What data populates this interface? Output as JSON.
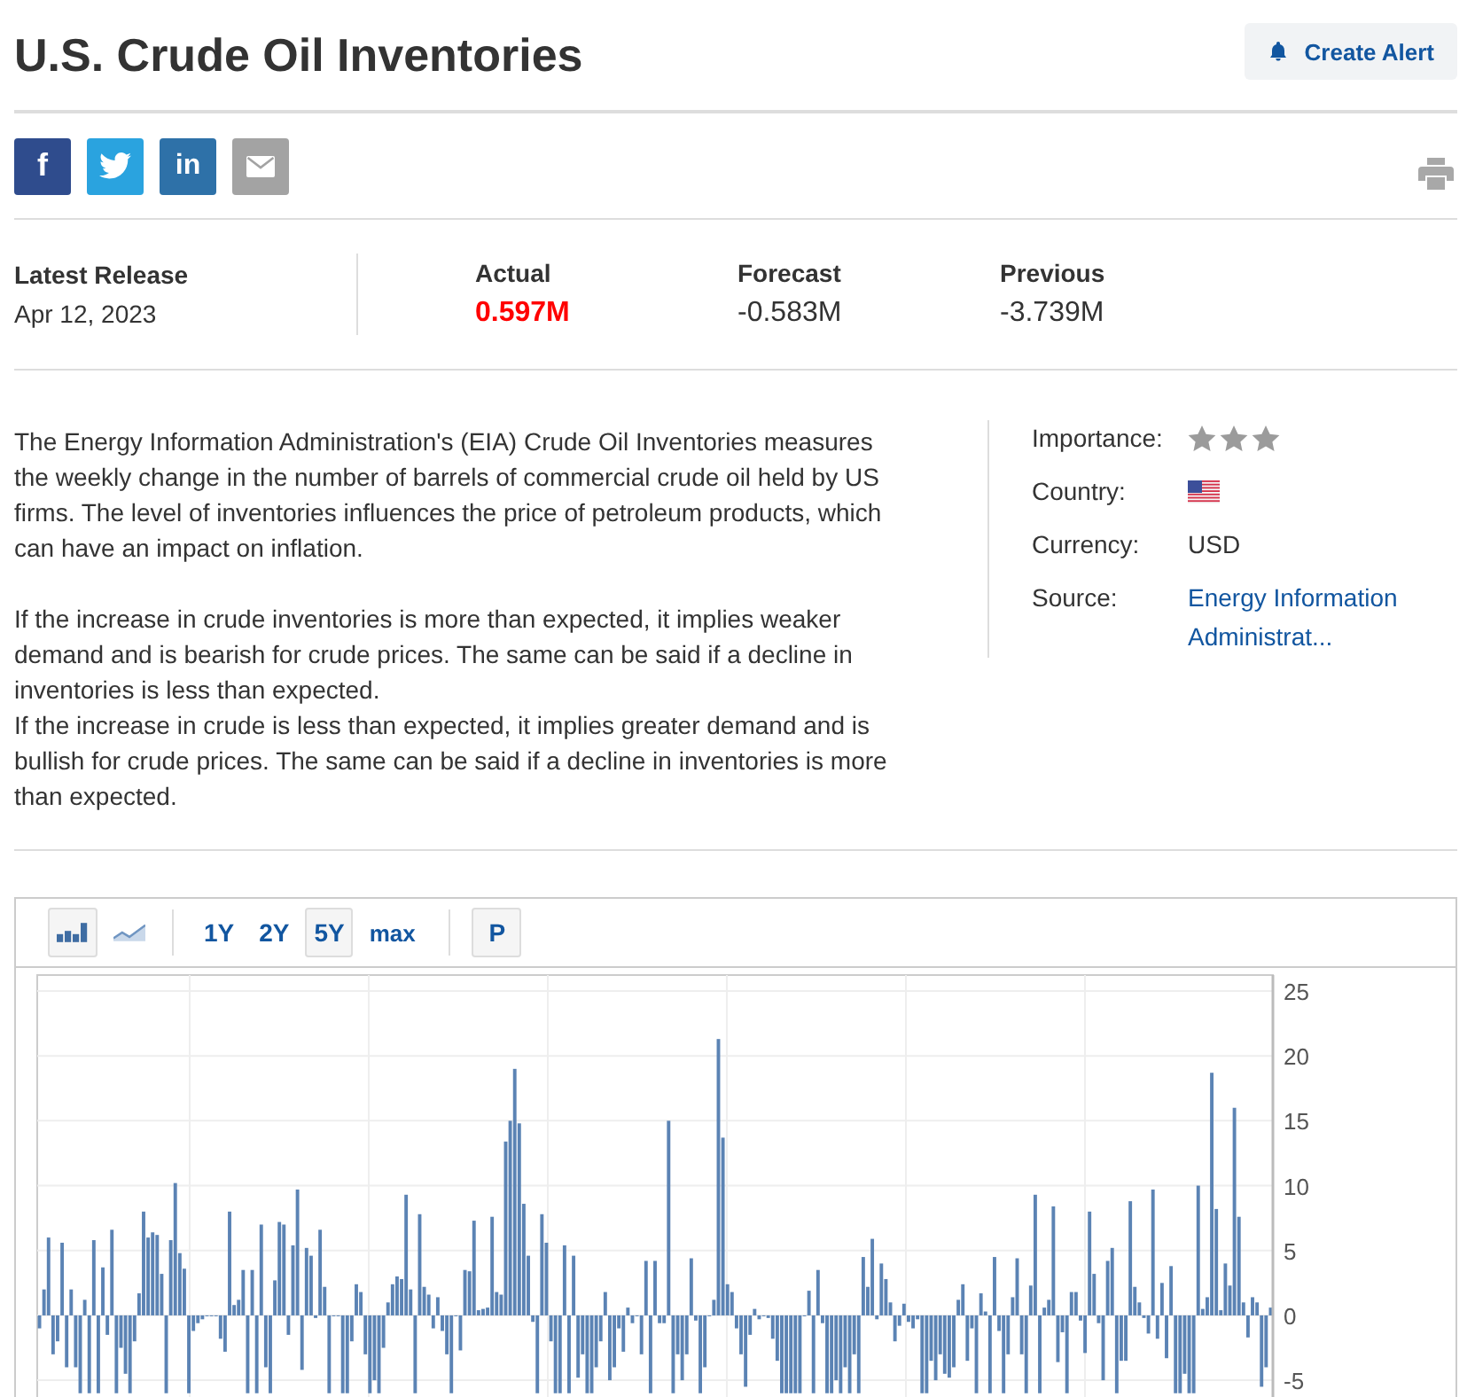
{
  "title": "U.S. Crude Oil Inventories",
  "alert_button": {
    "label": "Create Alert"
  },
  "share_buttons": [
    {
      "kind": "facebook",
      "label": "f"
    },
    {
      "kind": "twitter"
    },
    {
      "kind": "linkedin",
      "label": "in"
    },
    {
      "kind": "email"
    }
  ],
  "release": {
    "label": "Latest Release",
    "date": "Apr 12, 2023"
  },
  "figures": [
    {
      "label": "Actual",
      "value": "0.597M",
      "highlight": true
    },
    {
      "label": "Forecast",
      "value": "-0.583M",
      "highlight": false
    },
    {
      "label": "Previous",
      "value": "-3.739M",
      "highlight": false
    }
  ],
  "description": [
    [
      "The Energy Information Administration's (EIA) Crude Oil Inventories measures the weekly change in the number of barrels of commercial crude oil held by US firms. The level of inventories influences the price of petroleum products, which can have an impact on inflation."
    ],
    [
      "If the increase in crude inventories is more than expected, it implies weaker demand and is bearish for crude prices. The same can be said if a decline in inventories is less than expected.",
      "If the increase in crude is less than expected, it implies greater demand and is bullish for crude prices. The same can be said if a decline in inventories is more than expected."
    ]
  ],
  "details": [
    {
      "kind": "stars",
      "label": "Importance:",
      "stars": 3
    },
    {
      "kind": "flag",
      "label": "Country:"
    },
    {
      "kind": "text",
      "label": "Currency:",
      "value": "USD"
    },
    {
      "kind": "link",
      "label": "Source:",
      "value": "Energy Information Administrat..."
    }
  ],
  "chart_toolbar": {
    "chart_types": [
      {
        "kind": "bar",
        "selected": true
      },
      {
        "kind": "line",
        "selected": false
      }
    ],
    "ranges": [
      {
        "label": "1Y",
        "selected": false
      },
      {
        "label": "2Y",
        "selected": false
      },
      {
        "label": "5Y",
        "selected": true
      },
      {
        "label": "max",
        "selected": false
      }
    ],
    "p_button": {
      "label": "P"
    }
  },
  "chart": {
    "chart_data": {
      "type": "bar",
      "grid": true,
      "ylim": [
        -6.7,
        25
      ],
      "yticks": [
        -5,
        0,
        5,
        10,
        15,
        20,
        25
      ],
      "values": [
        -1,
        2,
        6,
        -3,
        -2,
        5.6,
        -4,
        2,
        -4,
        -6,
        1.2,
        -6,
        5.8,
        -6,
        3.7,
        -1.5,
        6.6,
        -6,
        -2.5,
        -4.5,
        -6,
        -2,
        1.7,
        8,
        6,
        6.4,
        6.2,
        3.2,
        -6,
        5.8,
        10.2,
        4.8,
        3.6,
        -6,
        -1.2,
        -0.6,
        -0.3,
        0,
        0,
        0,
        -1.8,
        -2.8,
        8,
        0.8,
        1.2,
        3.5,
        -6,
        3.5,
        -6,
        7,
        -4,
        -6,
        2.7,
        7.2,
        7,
        -1.5,
        5.4,
        9.7,
        -4.2,
        5.2,
        4.6,
        -0.2,
        6.6,
        2.2,
        -6,
        0,
        0,
        -6,
        -6,
        -2,
        2.4,
        1.8,
        -3,
        -6,
        -5,
        -6,
        -2.5,
        1,
        2.4,
        3,
        2.8,
        9.3,
        2,
        -6,
        7.8,
        2.2,
        1.6,
        -1,
        1.4,
        -1.2,
        -3,
        -6,
        0,
        -2.7,
        3.5,
        3.4,
        7.3,
        0.4,
        0.5,
        0.6,
        7.6,
        1.8,
        1.6,
        13.4,
        15,
        19,
        14.8,
        8.6,
        4.6,
        -0.5,
        -6,
        7.8,
        5.6,
        -2,
        -6,
        -6,
        5.4,
        -6,
        4.6,
        -4.8,
        -3,
        -6,
        -6,
        -4,
        -2,
        1.8,
        -5,
        -4,
        -1,
        -2.8,
        0.6,
        -0.6,
        0,
        -3,
        4.2,
        -6,
        4.2,
        -0.6,
        -0.6,
        15,
        -6,
        -3,
        -5,
        -3,
        4.4,
        -0.4,
        -6,
        -4,
        0,
        1.2,
        21.3,
        13.7,
        2.4,
        1.8,
        -1,
        -3,
        -5.5,
        -1.5,
        0.5,
        -0.3,
        0,
        -0.2,
        -1.8,
        -3.5,
        -6,
        -6,
        -6,
        -6,
        -6,
        0,
        1.9,
        -6,
        3.5,
        -0.6,
        -6,
        -6,
        -5,
        -6,
        -4,
        -6,
        -3,
        -6,
        4.5,
        2.2,
        5.9,
        -0.3,
        4,
        2.8,
        1,
        -2,
        -0.8,
        0.9,
        -0.5,
        -1,
        -0.3,
        -6,
        -6,
        -3.5,
        -5,
        -3,
        -4.5,
        -4.8,
        -4,
        1.2,
        2.4,
        -3.5,
        -1,
        -6,
        1.7,
        0.3,
        -6,
        4.5,
        -1.2,
        -6,
        -3,
        1.4,
        4.4,
        -3,
        -6,
        2.3,
        9.3,
        -6,
        0.6,
        1.2,
        8.4,
        -3.6,
        -1.3,
        -6,
        1.8,
        1.8,
        -0.4,
        -2.9,
        8,
        3.2,
        -0.6,
        -5,
        4.2,
        5.2,
        -6,
        -3.5,
        -3.5,
        8.8,
        2.2,
        1,
        -0.2,
        -1.4,
        9.7,
        -1.8,
        2.5,
        -3.3,
        3.8,
        -6,
        -6,
        -4.5,
        -6,
        -6,
        10,
        0.5,
        1.4,
        18.7,
        8.2,
        0.4,
        4,
        2.3,
        16,
        7.6,
        1,
        -1.7,
        1.4,
        1,
        -5.5,
        -4,
        0.6
      ]
    }
  }
}
